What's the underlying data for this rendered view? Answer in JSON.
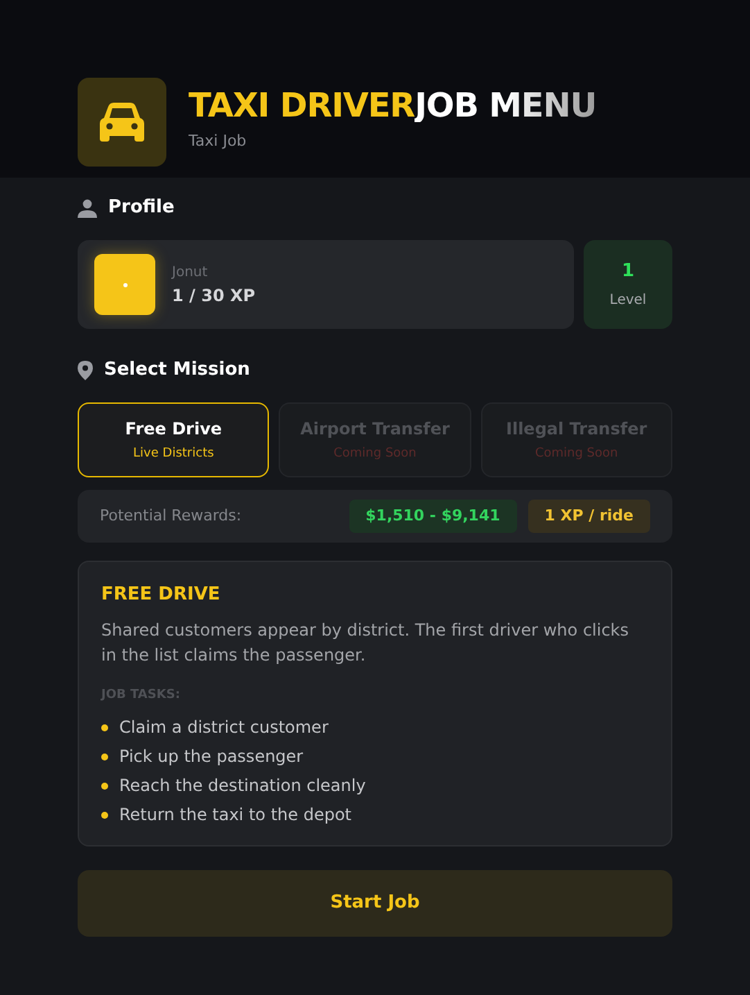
{
  "header": {
    "title_accent": "TAXI DRIVER",
    "title_rest": "JOB MENU",
    "subtitle": "Taxi Job"
  },
  "profile": {
    "heading": "Profile",
    "name": "Jonut",
    "xp": "1 / 30 XP",
    "level": "1",
    "level_label": "Level"
  },
  "missions": {
    "heading": "Select Mission",
    "items": [
      {
        "title": "Free Drive",
        "subtitle": "Live Districts",
        "selected": true,
        "disabled": false
      },
      {
        "title": "Airport Transfer",
        "subtitle": "Coming Soon",
        "selected": false,
        "disabled": true
      },
      {
        "title": "Illegal Transfer",
        "subtitle": "Coming Soon",
        "selected": false,
        "disabled": true
      }
    ]
  },
  "rewards": {
    "label": "Potential Rewards:",
    "money": "$1,510 - $9,141",
    "xp": "1 XP / ride"
  },
  "details": {
    "title": "FREE DRIVE",
    "description": "Shared customers appear by district. The first driver who clicks in the list claims the passenger.",
    "tasks_heading": "JOB TASKS:",
    "tasks": [
      "Claim a district customer",
      "Pick up the passenger",
      "Reach the destination cleanly",
      "Return the taxi to the depot"
    ]
  },
  "start_button": "Start Job"
}
